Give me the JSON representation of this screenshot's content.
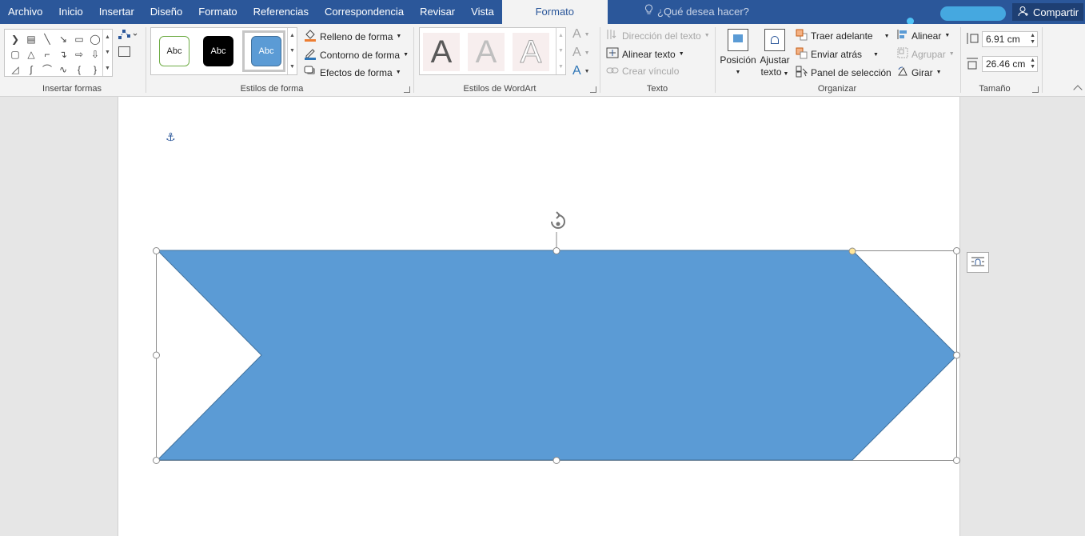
{
  "tabs": [
    "Archivo",
    "Inicio",
    "Insertar",
    "Diseño",
    "Formato",
    "Referencias",
    "Correspondencia",
    "Revisar",
    "Vista",
    "Formato"
  ],
  "active_tab_index": 9,
  "tell_me": "¿Qué desea hacer?",
  "share": "Compartir",
  "groups": {
    "insert_shapes": "Insertar formas",
    "shape_styles": "Estilos de forma",
    "wordart_styles": "Estilos de WordArt",
    "text": "Texto",
    "arrange": "Organizar",
    "size": "Tamaño"
  },
  "shape_style_samples": [
    "Abc",
    "Abc",
    "Abc"
  ],
  "shape_style_buttons": {
    "fill": "Relleno de forma",
    "outline": "Contorno de forma",
    "effects": "Efectos de forma"
  },
  "wordart_samples": [
    "A",
    "A",
    "A"
  ],
  "text_buttons": {
    "direction": "Dirección del texto",
    "align": "Alinear texto",
    "link": "Crear vínculo"
  },
  "arrange_buttons": {
    "position": "Posición",
    "wrap_line1": "Ajustar",
    "wrap_line2": "texto",
    "bring_forward": "Traer adelante",
    "send_backward": "Enviar atrás",
    "selection_pane": "Panel de selección",
    "align": "Alinear",
    "group": "Agrupar",
    "rotate": "Girar"
  },
  "size": {
    "height": "6.91 cm",
    "width": "26.46 cm"
  },
  "colors": {
    "ribbon_blue": "#2b579a",
    "shape_fill": "#5b9bd5",
    "shape_stroke": "#41719c"
  }
}
